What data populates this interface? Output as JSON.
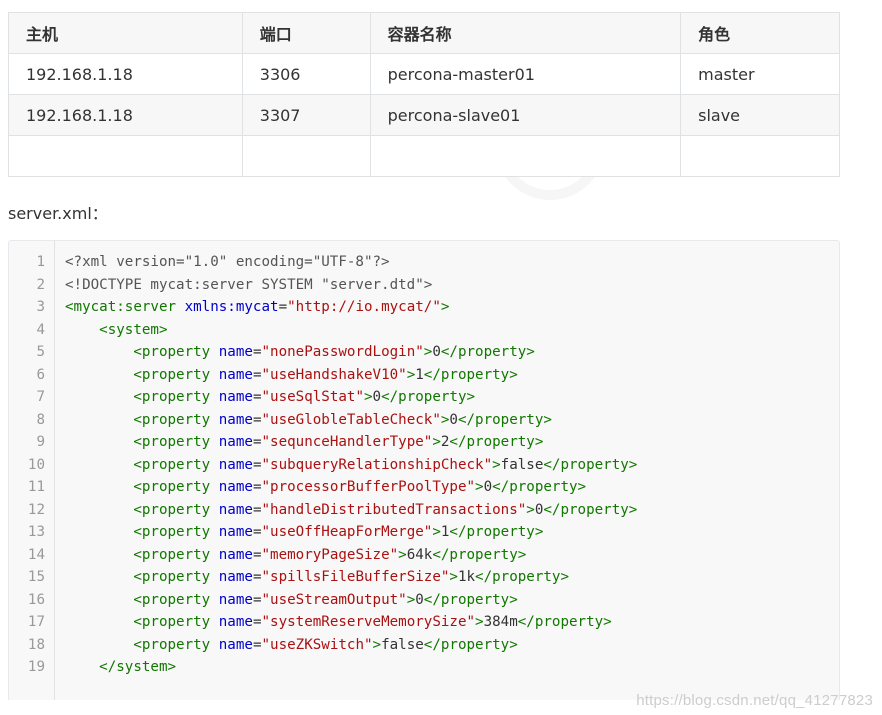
{
  "table": {
    "headers": [
      "主机",
      "端口",
      "容器名称",
      "角色"
    ],
    "rows": [
      [
        "192.168.1.18",
        "3306",
        "percona-master01",
        "master"
      ],
      [
        "192.168.1.18",
        "3307",
        "percona-slave01",
        "slave"
      ],
      [
        "",
        "",
        "",
        ""
      ]
    ]
  },
  "caption": "server.xml：",
  "code": {
    "line_numbers": [
      "1",
      "2",
      "3",
      "4",
      "5",
      "6",
      "7",
      "8",
      "9",
      "10",
      "11",
      "12",
      "13",
      "14",
      "15",
      "16",
      "17",
      "18",
      "19"
    ],
    "lines": [
      [
        {
          "c": "meta",
          "t": "<?xml version=\"1.0\" encoding=\"UTF-8\"?>"
        }
      ],
      [
        {
          "c": "meta",
          "t": "<!DOCTYPE mycat:server SYSTEM \"server.dtd\">"
        }
      ],
      [
        {
          "c": "tag",
          "t": "<mycat:server"
        },
        {
          "c": "text",
          "t": " "
        },
        {
          "c": "attr",
          "t": "xmlns:mycat"
        },
        {
          "c": "text",
          "t": "="
        },
        {
          "c": "str",
          "t": "\"http://io.mycat/\""
        },
        {
          "c": "tag",
          "t": ">"
        }
      ],
      [
        {
          "c": "text",
          "t": "    "
        },
        {
          "c": "tag",
          "t": "<system>"
        }
      ],
      [
        {
          "c": "text",
          "t": "        "
        },
        {
          "c": "tag",
          "t": "<property"
        },
        {
          "c": "text",
          "t": " "
        },
        {
          "c": "attr",
          "t": "name"
        },
        {
          "c": "text",
          "t": "="
        },
        {
          "c": "str",
          "t": "\"nonePasswordLogin\""
        },
        {
          "c": "tag",
          "t": ">"
        },
        {
          "c": "text",
          "t": "0"
        },
        {
          "c": "tag",
          "t": "</property>"
        }
      ],
      [
        {
          "c": "text",
          "t": "        "
        },
        {
          "c": "tag",
          "t": "<property"
        },
        {
          "c": "text",
          "t": " "
        },
        {
          "c": "attr",
          "t": "name"
        },
        {
          "c": "text",
          "t": "="
        },
        {
          "c": "str",
          "t": "\"useHandshakeV10\""
        },
        {
          "c": "tag",
          "t": ">"
        },
        {
          "c": "text",
          "t": "1"
        },
        {
          "c": "tag",
          "t": "</property>"
        }
      ],
      [
        {
          "c": "text",
          "t": "        "
        },
        {
          "c": "tag",
          "t": "<property"
        },
        {
          "c": "text",
          "t": " "
        },
        {
          "c": "attr",
          "t": "name"
        },
        {
          "c": "text",
          "t": "="
        },
        {
          "c": "str",
          "t": "\"useSqlStat\""
        },
        {
          "c": "tag",
          "t": ">"
        },
        {
          "c": "text",
          "t": "0"
        },
        {
          "c": "tag",
          "t": "</property>"
        }
      ],
      [
        {
          "c": "text",
          "t": "        "
        },
        {
          "c": "tag",
          "t": "<property"
        },
        {
          "c": "text",
          "t": " "
        },
        {
          "c": "attr",
          "t": "name"
        },
        {
          "c": "text",
          "t": "="
        },
        {
          "c": "str",
          "t": "\"useGlobleTableCheck\""
        },
        {
          "c": "tag",
          "t": ">"
        },
        {
          "c": "text",
          "t": "0"
        },
        {
          "c": "tag",
          "t": "</property>"
        }
      ],
      [
        {
          "c": "text",
          "t": "        "
        },
        {
          "c": "tag",
          "t": "<property"
        },
        {
          "c": "text",
          "t": " "
        },
        {
          "c": "attr",
          "t": "name"
        },
        {
          "c": "text",
          "t": "="
        },
        {
          "c": "str",
          "t": "\"sequnceHandlerType\""
        },
        {
          "c": "tag",
          "t": ">"
        },
        {
          "c": "text",
          "t": "2"
        },
        {
          "c": "tag",
          "t": "</property>"
        }
      ],
      [
        {
          "c": "text",
          "t": "        "
        },
        {
          "c": "tag",
          "t": "<property"
        },
        {
          "c": "text",
          "t": " "
        },
        {
          "c": "attr",
          "t": "name"
        },
        {
          "c": "text",
          "t": "="
        },
        {
          "c": "str",
          "t": "\"subqueryRelationshipCheck\""
        },
        {
          "c": "tag",
          "t": ">"
        },
        {
          "c": "text",
          "t": "false"
        },
        {
          "c": "tag",
          "t": "</property>"
        }
      ],
      [
        {
          "c": "text",
          "t": "        "
        },
        {
          "c": "tag",
          "t": "<property"
        },
        {
          "c": "text",
          "t": " "
        },
        {
          "c": "attr",
          "t": "name"
        },
        {
          "c": "text",
          "t": "="
        },
        {
          "c": "str",
          "t": "\"processorBufferPoolType\""
        },
        {
          "c": "tag",
          "t": ">"
        },
        {
          "c": "text",
          "t": "0"
        },
        {
          "c": "tag",
          "t": "</property>"
        }
      ],
      [
        {
          "c": "text",
          "t": "        "
        },
        {
          "c": "tag",
          "t": "<property"
        },
        {
          "c": "text",
          "t": " "
        },
        {
          "c": "attr",
          "t": "name"
        },
        {
          "c": "text",
          "t": "="
        },
        {
          "c": "str",
          "t": "\"handleDistributedTransactions\""
        },
        {
          "c": "tag",
          "t": ">"
        },
        {
          "c": "text",
          "t": "0"
        },
        {
          "c": "tag",
          "t": "</property>"
        }
      ],
      [
        {
          "c": "text",
          "t": "        "
        },
        {
          "c": "tag",
          "t": "<property"
        },
        {
          "c": "text",
          "t": " "
        },
        {
          "c": "attr",
          "t": "name"
        },
        {
          "c": "text",
          "t": "="
        },
        {
          "c": "str",
          "t": "\"useOffHeapForMerge\""
        },
        {
          "c": "tag",
          "t": ">"
        },
        {
          "c": "text",
          "t": "1"
        },
        {
          "c": "tag",
          "t": "</property>"
        }
      ],
      [
        {
          "c": "text",
          "t": "        "
        },
        {
          "c": "tag",
          "t": "<property"
        },
        {
          "c": "text",
          "t": " "
        },
        {
          "c": "attr",
          "t": "name"
        },
        {
          "c": "text",
          "t": "="
        },
        {
          "c": "str",
          "t": "\"memoryPageSize\""
        },
        {
          "c": "tag",
          "t": ">"
        },
        {
          "c": "text",
          "t": "64k"
        },
        {
          "c": "tag",
          "t": "</property>"
        }
      ],
      [
        {
          "c": "text",
          "t": "        "
        },
        {
          "c": "tag",
          "t": "<property"
        },
        {
          "c": "text",
          "t": " "
        },
        {
          "c": "attr",
          "t": "name"
        },
        {
          "c": "text",
          "t": "="
        },
        {
          "c": "str",
          "t": "\"spillsFileBufferSize\""
        },
        {
          "c": "tag",
          "t": ">"
        },
        {
          "c": "text",
          "t": "1k"
        },
        {
          "c": "tag",
          "t": "</property>"
        }
      ],
      [
        {
          "c": "text",
          "t": "        "
        },
        {
          "c": "tag",
          "t": "<property"
        },
        {
          "c": "text",
          "t": " "
        },
        {
          "c": "attr",
          "t": "name"
        },
        {
          "c": "text",
          "t": "="
        },
        {
          "c": "str",
          "t": "\"useStreamOutput\""
        },
        {
          "c": "tag",
          "t": ">"
        },
        {
          "c": "text",
          "t": "0"
        },
        {
          "c": "tag",
          "t": "</property>"
        }
      ],
      [
        {
          "c": "text",
          "t": "        "
        },
        {
          "c": "tag",
          "t": "<property"
        },
        {
          "c": "text",
          "t": " "
        },
        {
          "c": "attr",
          "t": "name"
        },
        {
          "c": "text",
          "t": "="
        },
        {
          "c": "str",
          "t": "\"systemReserveMemorySize\""
        },
        {
          "c": "tag",
          "t": ">"
        },
        {
          "c": "text",
          "t": "384m"
        },
        {
          "c": "tag",
          "t": "</property>"
        }
      ],
      [
        {
          "c": "text",
          "t": "        "
        },
        {
          "c": "tag",
          "t": "<property"
        },
        {
          "c": "text",
          "t": " "
        },
        {
          "c": "attr",
          "t": "name"
        },
        {
          "c": "text",
          "t": "="
        },
        {
          "c": "str",
          "t": "\"useZKSwitch\""
        },
        {
          "c": "tag",
          "t": ">"
        },
        {
          "c": "text",
          "t": "false"
        },
        {
          "c": "tag",
          "t": "</property>"
        }
      ],
      [
        {
          "c": "text",
          "t": "    "
        },
        {
          "c": "tag",
          "t": "</system>"
        }
      ]
    ]
  },
  "watermark": "https://blog.csdn.net/qq_41277823",
  "colors": {
    "tag": "#117700",
    "attr": "#0000cc",
    "string": "#aa1111",
    "meta": "#555555",
    "line_number": "#999999",
    "code_background": "#f8f8f8",
    "table_border": "#dfe2e5"
  }
}
